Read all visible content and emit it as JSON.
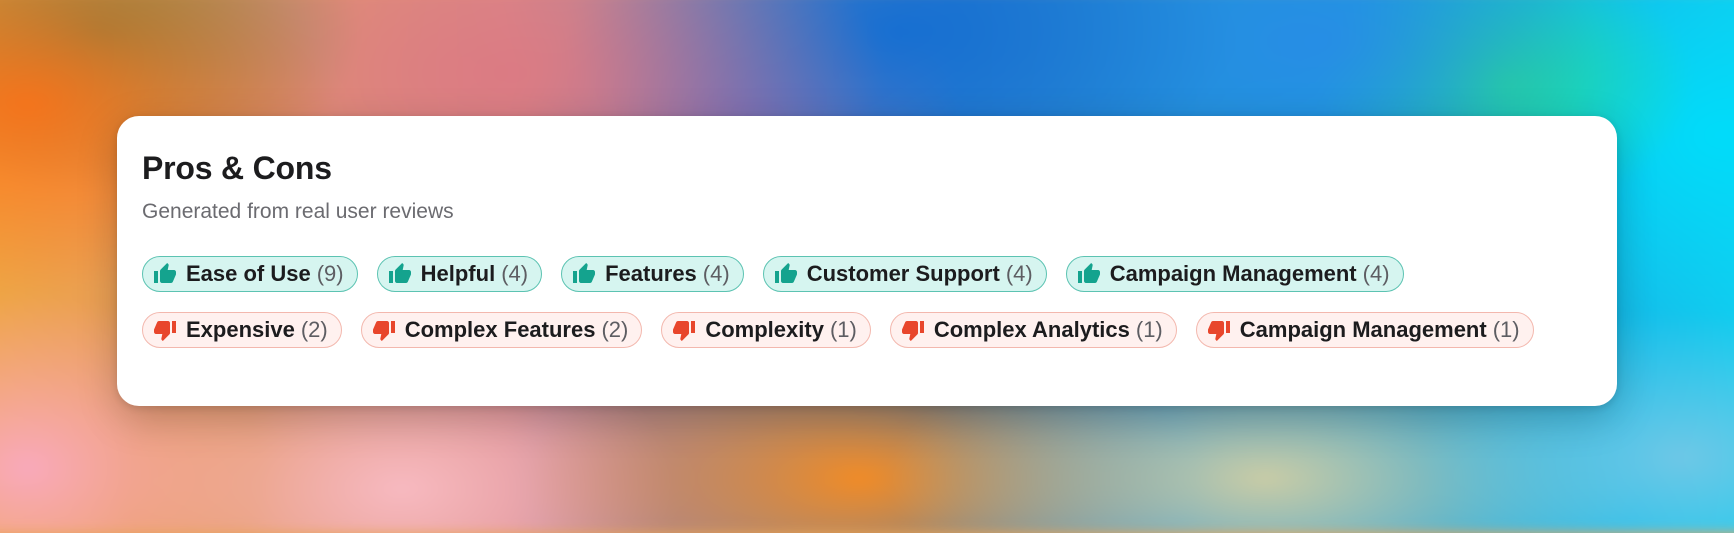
{
  "card": {
    "title": "Pros & Cons",
    "subtitle": "Generated from real user reviews"
  },
  "colors": {
    "pro_accent": "#14a38e",
    "con_accent": "#e8462c"
  },
  "tags": [
    {
      "type": "pro",
      "icon": "thumbs-up-icon",
      "label": "Ease of Use",
      "count": "(9)"
    },
    {
      "type": "pro",
      "icon": "thumbs-up-icon",
      "label": "Helpful",
      "count": "(4)"
    },
    {
      "type": "pro",
      "icon": "thumbs-up-icon",
      "label": "Features",
      "count": "(4)"
    },
    {
      "type": "pro",
      "icon": "thumbs-up-icon",
      "label": "Customer Support",
      "count": "(4)"
    },
    {
      "type": "pro",
      "icon": "thumbs-up-icon",
      "label": "Campaign Management",
      "count": "(4)"
    },
    {
      "type": "con",
      "icon": "thumbs-down-icon",
      "label": "Expensive",
      "count": "(2)"
    },
    {
      "type": "con",
      "icon": "thumbs-down-icon",
      "label": "Complex Features",
      "count": "(2)"
    },
    {
      "type": "con",
      "icon": "thumbs-down-icon",
      "label": "Complexity",
      "count": "(1)"
    },
    {
      "type": "con",
      "icon": "thumbs-down-icon",
      "label": "Complex Analytics",
      "count": "(1)"
    },
    {
      "type": "con",
      "icon": "thumbs-down-icon",
      "label": "Campaign Management",
      "count": "(1)"
    }
  ]
}
